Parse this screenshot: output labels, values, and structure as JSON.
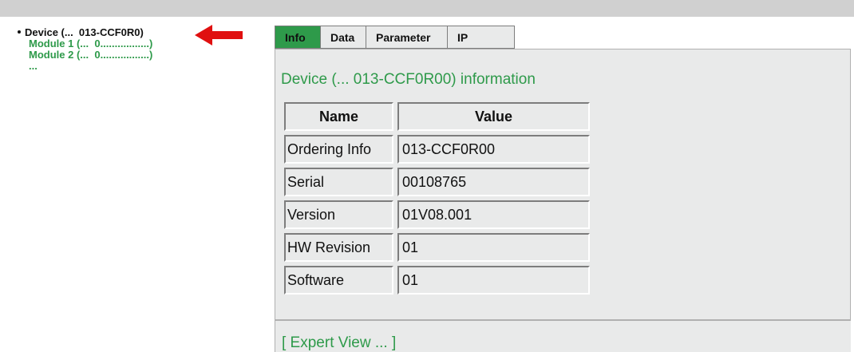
{
  "tree": {
    "device": "Device (...  013-CCF0R0)",
    "module1": "Module 1 (...  0.................)",
    "module2": "Module 2 (...  0.................)",
    "more": "..."
  },
  "tabs": [
    "Info",
    "Data",
    "Parameter",
    "IP"
  ],
  "active_tab": "Info",
  "info": {
    "title": "Device (...  013-CCF0R00) information",
    "headers": {
      "name": "Name",
      "value": "Value"
    },
    "rows": [
      {
        "name": "Ordering Info",
        "value": "013-CCF0R00"
      },
      {
        "name": "Serial",
        "value": "00108765"
      },
      {
        "name": "Version",
        "value": "01V08.001"
      },
      {
        "name": "HW Revision",
        "value": "01"
      },
      {
        "name": "Software",
        "value": "01"
      }
    ]
  },
  "footer": {
    "expert_view": "[ Expert View ... ]"
  },
  "colors": {
    "accent_green": "#2e9a4a",
    "arrow_red": "#e01010",
    "panel_bg": "#e9eaea"
  },
  "icons": {
    "arrow": "red-left-arrow-icon"
  }
}
